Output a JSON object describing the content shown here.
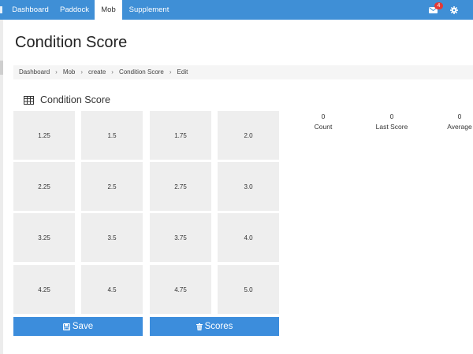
{
  "nav": {
    "tabs": [
      {
        "label": "Dashboard",
        "active": false
      },
      {
        "label": "Paddock",
        "active": false
      },
      {
        "label": "Mob",
        "active": true
      },
      {
        "label": "Supplement",
        "active": false
      }
    ],
    "mail_badge": "4",
    "colors": {
      "bar": "#3f8fd6",
      "active_tab": "#ffffff"
    },
    "icons": [
      "envelope-icon",
      "gear-icon"
    ]
  },
  "page": {
    "title": "Condition Score"
  },
  "breadcrumb": [
    "Dashboard",
    "Mob",
    "create",
    "Condition Score",
    "Edit"
  ],
  "panel": {
    "title": "Condition Score",
    "icon": "table-grid-icon"
  },
  "scores": [
    "1.25",
    "1.5",
    "1.75",
    "2.0",
    "2.25",
    "2.5",
    "2.75",
    "3.0",
    "3.25",
    "3.5",
    "3.75",
    "4.0",
    "4.25",
    "4.5",
    "4.75",
    "5.0"
  ],
  "buttons": {
    "save_label": "Save",
    "scores_label": "Scores",
    "color": "#3c8ddc"
  },
  "stats": [
    {
      "value": "0",
      "label": "Count"
    },
    {
      "value": "0",
      "label": "Last Score"
    },
    {
      "value": "0",
      "label": "Average"
    }
  ]
}
